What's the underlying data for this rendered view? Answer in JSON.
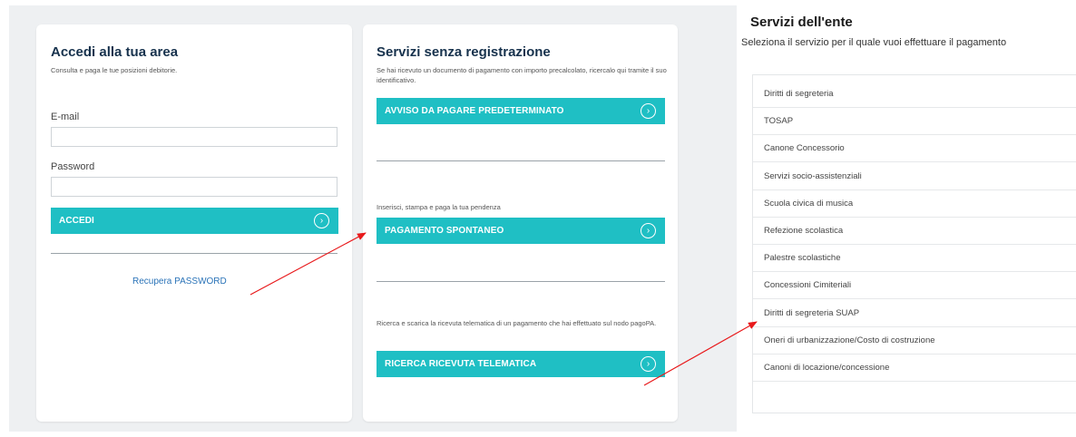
{
  "login": {
    "title": "Accedi alla tua area",
    "subtitle": "Consulta e paga le tue posizioni debitorie.",
    "email_label": "E-mail",
    "email_value": "",
    "password_label": "Password",
    "password_value": "",
    "submit_label": "ACCEDI",
    "recover_label": "Recupera PASSWORD"
  },
  "services": {
    "title": "Servizi senza registrazione",
    "intro": "Se hai ricevuto un documento di pagamento con importo precalcolato, ricercalo qui tramite il suo identificativo.",
    "avviso_label": "AVVISO DA PAGARE PREDETERMINATO",
    "spontaneo_text": "Inserisci, stampa e paga la tua pendenza",
    "spontaneo_label": "PAGAMENTO SPONTANEO",
    "ricevuta_text": "Ricerca e scarica la ricevuta telematica di un pagamento che hai effettuato sul nodo pagoPA.",
    "ricevuta_label": "RICERCA RICEVUTA TELEMATICA"
  },
  "ente": {
    "title": "Servizi dell'ente",
    "subtitle": "Seleziona il servizio per il quale vuoi effettuare il pagamento",
    "items": [
      "Diritti di segreteria",
      "TOSAP",
      "Canone Concessorio",
      "Servizi socio-assistenziali",
      "Scuola civica di musica",
      "Refezione scolastica",
      "Palestre scolastiche",
      "Concessioni Cimiteriali",
      "Diritti di segreteria SUAP",
      "Oneri di urbanizzazione/Costo di costruzione",
      "Canoni di locazione/concessione"
    ]
  },
  "icons": {
    "button_chevron": "chevron-right-circle-icon",
    "arrow": "red-arrow-annotation"
  },
  "colors": {
    "accent": "#1fbfc4",
    "title": "#17324d",
    "link": "#2a73b8",
    "annotation": "#e8191b"
  }
}
